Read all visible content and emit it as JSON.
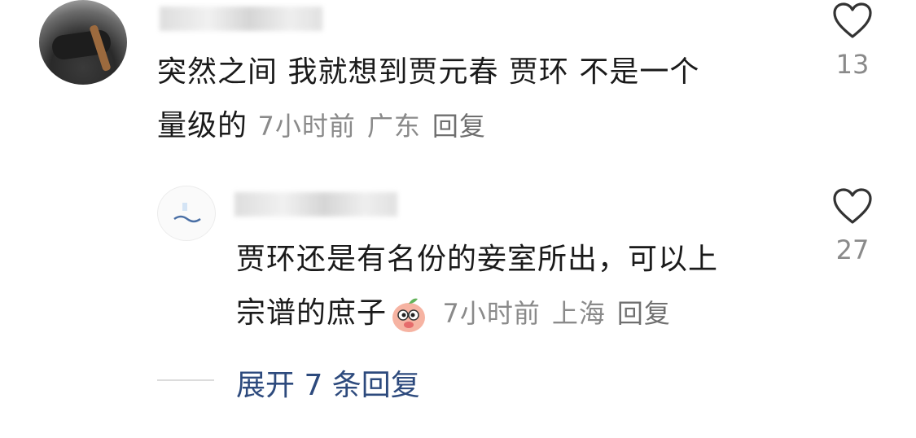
{
  "comments": [
    {
      "text_line1": "突然之间 我就想到贾元春 贾环 不是一个",
      "text_line2": "量级的",
      "time": "7小时前",
      "location": "广东",
      "reply_label": "回复",
      "likes": "13"
    },
    {
      "text_line1": "贾环还是有名份的妾室所出，可以上",
      "text_line2": "宗谱的庶子",
      "time": "7小时前",
      "location": "上海",
      "reply_label": "回复",
      "likes": "27"
    }
  ],
  "expand_replies": "展开 7 条回复",
  "icons": [
    "heart-icon",
    "peach-emoji-icon"
  ],
  "colors": {
    "text": "#1a1a1a",
    "meta": "#8a8a8a",
    "link": "#2d4a7d"
  }
}
